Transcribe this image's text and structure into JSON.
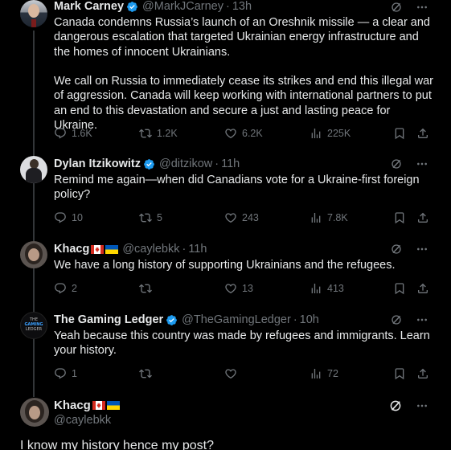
{
  "posts": [
    {
      "name": "Mark Carney",
      "handle": "@MarkJCarney",
      "time": "13h",
      "text": "Canada condemns Russia’s launch of an Oreshnik missile — a clear and dangerous escalation that targeted Ukrainian energy infrastructure and the homes of innocent Ukrainians.\n\nWe call on Russia to immediately cease its strikes and end this illegal war of aggression. Canada will keep working with international partners to put an end to this devastation and secure a just and lasting peace for Ukraine.",
      "replies": "1.6K",
      "reposts": "1.2K",
      "likes": "6.2K",
      "views": "225K"
    },
    {
      "name": "Dylan Itzikowitz",
      "handle": "@ditzikow",
      "time": "11h",
      "text": "Remind me again—when did Canadians vote for a Ukraine-first foreign policy?",
      "replies": "10",
      "reposts": "5",
      "likes": "243",
      "views": "7.8K"
    },
    {
      "name": "Khacg",
      "handle": "@caylebkk",
      "time": "11h",
      "text": "We have a long history of supporting Ukrainians and the refugees.",
      "replies": "2",
      "reposts": "",
      "likes": "13",
      "views": "413"
    },
    {
      "name": "The Gaming Ledger",
      "handle": "@TheGamingLedger",
      "time": "10h",
      "text": "Yeah because this country was made by refugees and immigrants. Learn your history.",
      "replies": "1",
      "reposts": "",
      "likes": "",
      "views": "72",
      "avatar_text_1": "THE",
      "avatar_text_2": "GAMING",
      "avatar_text_3": "LEDGER"
    }
  ],
  "main": {
    "name": "Khacg",
    "handle": "@caylebkk",
    "text": "I know my history hence my post?"
  },
  "icons": {
    "more": "more-icon",
    "grok": "grok-icon",
    "reply": "reply-icon",
    "repost": "repost-icon",
    "like": "like-icon",
    "views": "views-icon",
    "bookmark": "bookmark-icon",
    "share": "share-icon",
    "verified": "verified-badge-icon"
  },
  "colors": {
    "background": "#000000",
    "text": "#e7e9ea",
    "muted": "#71767b",
    "verified": "#1d9bf0",
    "thread_line": "#333639"
  }
}
